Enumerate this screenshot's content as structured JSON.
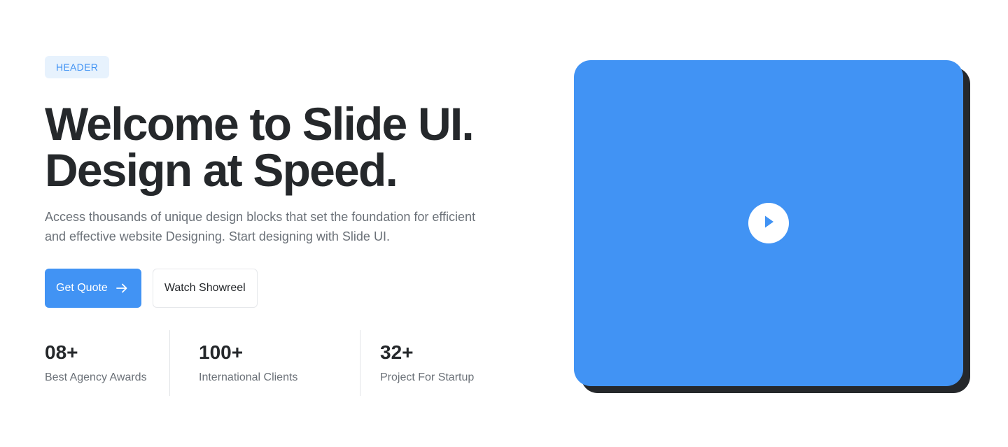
{
  "hero": {
    "tag": "HEADER",
    "headline_line1": "Welcome to Slide UI.",
    "headline_line2": "Design at Speed.",
    "description": "Access thousands of unique design blocks that set the foundation for efficient and effective website Designing. Start designing with Slide UI."
  },
  "actions": {
    "primary_label": "Get Quote",
    "primary_icon": "arrow-right-icon",
    "secondary_label": "Watch Showreel"
  },
  "stats": [
    {
      "value": "08+",
      "label": "Best Agency Awards"
    },
    {
      "value": "100+",
      "label": "International Clients"
    },
    {
      "value": "32+",
      "label": "Project For Startup"
    }
  ],
  "media": {
    "icon": "play-icon"
  },
  "colors": {
    "accent": "#4193f4",
    "tag_background": "#e7f2fd",
    "heading_text": "#25282b",
    "body_text": "#6b7178",
    "media_shadow": "#25282b"
  }
}
